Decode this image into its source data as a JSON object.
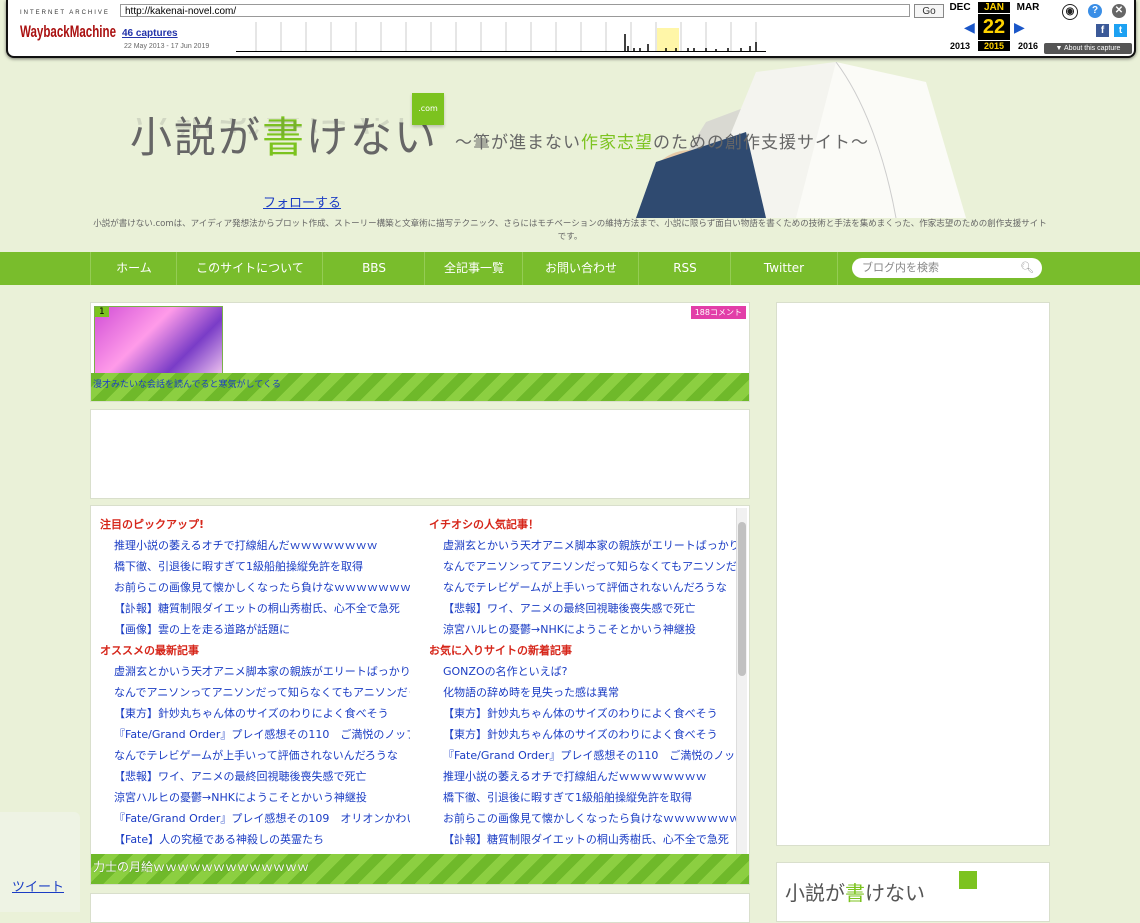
{
  "wayback": {
    "ia_label": "INTERNET ARCHIVE",
    "logo_text": "WaybackMachine",
    "url": "http://kakenai-novel.com/",
    "go": "Go",
    "captures": "46 captures",
    "range": "22 May 2013 - 17 Jun 2019",
    "months": [
      "DEC",
      "JAN",
      "MAR"
    ],
    "day": "22",
    "years": [
      "2013",
      "2015",
      "2016"
    ],
    "about": "▼ About this capture",
    "icons": [
      "user-icon",
      "help-icon",
      "close-icon",
      "facebook-icon",
      "twitter-icon"
    ]
  },
  "header": {
    "title_a": "小説が",
    "title_b": "書",
    "title_c": "けない",
    "com": ".com",
    "subtitle_a": "～筆が進まない",
    "subtitle_b": "作家志望",
    "subtitle_c": "のための創作支援サイト～",
    "follow": "フォローする",
    "description": "小説が書けない.comは、アイディア発想法からプロット作成、ストーリー構築と文章術に描写テクニック、さらにはモチベーションの維持方法まで、小説に限らず面白い物語を書くための技術と手法を集めまくった、作家志望のための創作支援サイトです。"
  },
  "nav": {
    "items": [
      "ホーム",
      "このサイトについて",
      "BBS",
      "全記事一覧",
      "お問い合わせ",
      "RSS",
      "Twitter"
    ],
    "search_placeholder": "ブログ内を検索"
  },
  "feature": {
    "rank": "1",
    "comment": "188コメント",
    "caption": "漫才みたいな会話を読んでると寒気がしてくる"
  },
  "links": {
    "col1": [
      {
        "type": "hd",
        "text": "注目のピックアップ!"
      },
      {
        "type": "lk",
        "text": "推理小説の萎えるオチで打線組んだｗｗｗｗｗｗｗｗ"
      },
      {
        "type": "lk",
        "text": "橋下徹、引退後に暇すぎて1級船舶操縦免許を取得"
      },
      {
        "type": "lk",
        "text": "お前らこの画像見て懐かしくなったら負けなｗｗｗｗｗｗｗ"
      },
      {
        "type": "lk",
        "text": "【訃報】糖質制限ダイエットの桐山秀樹氏、心不全で急死"
      },
      {
        "type": "lk",
        "text": "【画像】雲の上を走る道路が話題に"
      },
      {
        "type": "hd",
        "text": "オススメの最新記事"
      },
      {
        "type": "lk",
        "text": "虚淵玄とかいう天才アニメ脚本家の親族がエリートばっかりな件"
      },
      {
        "type": "lk",
        "text": "なんでアニソンってアニソンだって知らなくてもアニソンだってわかるの？"
      },
      {
        "type": "lk",
        "text": "【東方】針妙丸ちゃん体のサイズのわりによく食べそう"
      },
      {
        "type": "lk",
        "text": "『Fate/Grand Order』プレイ感想その110　ご満悦のノッブ"
      },
      {
        "type": "lk",
        "text": "なんでテレビゲームが上手いって評価されないんだろうな"
      },
      {
        "type": "lk",
        "text": "【悲報】ワイ、アニメの最終回視聴後喪失感で死亡"
      },
      {
        "type": "lk",
        "text": "涼宮ハルヒの憂鬱→NHKにようこそとかいう神継投"
      },
      {
        "type": "lk",
        "text": "『Fate/Grand Order』プレイ感想その109　オリオンかわいい"
      },
      {
        "type": "lk",
        "text": "【Fate】人の究極である神殺しの英霊たち"
      }
    ],
    "col2": [
      {
        "type": "hd",
        "text": "イチオシの人気記事！"
      },
      {
        "type": "lk",
        "text": "虚淵玄とかいう天才アニメ脚本家の親族がエリートばっかりな件"
      },
      {
        "type": "lk",
        "text": "なんでアニソンってアニソンだって知らなくてもアニソンだってわかるの？"
      },
      {
        "type": "lk",
        "text": "なんでテレビゲームが上手いって評価されないんだろうな"
      },
      {
        "type": "lk",
        "text": "【悲報】ワイ、アニメの最終回視聴後喪失感で死亡"
      },
      {
        "type": "lk",
        "text": "涼宮ハルヒの憂鬱→NHKにようこそとかいう神継投"
      },
      {
        "type": "hd",
        "text": "お気に入りサイトの新着記事"
      },
      {
        "type": "lk",
        "text": "GONZOの名作といえば?"
      },
      {
        "type": "lk",
        "text": "化物語の辞め時を見失った感は異常"
      },
      {
        "type": "lk",
        "text": "【東方】針妙丸ちゃん体のサイズのわりによく食べそう"
      },
      {
        "type": "lk",
        "text": "【東方】針妙丸ちゃん体のサイズのわりによく食べそう"
      },
      {
        "type": "lk",
        "text": "『Fate/Grand Order』プレイ感想その110　ご満悦のノッブ"
      },
      {
        "type": "lk",
        "text": "推理小説の萎えるオチで打線組んだｗｗｗｗｗｗｗｗ"
      },
      {
        "type": "lk",
        "text": "橋下徹、引退後に暇すぎて1級船舶操縦免許を取得"
      },
      {
        "type": "lk",
        "text": "お前らこの画像見て懐かしくなったら負けなｗｗｗｗｗｗｗ"
      },
      {
        "type": "lk",
        "text": "【訃報】糖質制限ダイエットの桐山秀樹氏、心不全で急死"
      }
    ],
    "footer_caption": "力士の月給ｗｗｗｗｗｗｗｗｗｗｗｗｗ"
  },
  "sidebar2": {
    "title_a": "小説が",
    "title_b": "書",
    "title_c": "けない"
  },
  "tweet": "ツイート",
  "colors": {
    "accent_green": "#79bd2c",
    "link_blue": "#1a3cc4",
    "heading_red": "#d6261a",
    "background": "#eaf1d8"
  }
}
